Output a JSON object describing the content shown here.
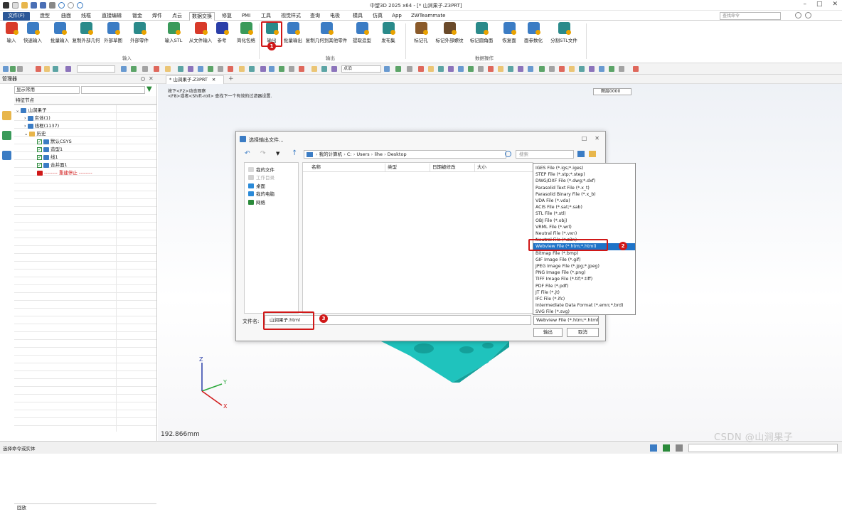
{
  "app_title": "中望3D 2025 x64 - [* 山涧果子.Z3PRT]",
  "search_cmd_placeholder": "查找命令",
  "menu": [
    "文件(F)",
    "造型",
    "曲面",
    "线框",
    "直接编辑",
    "钣金",
    "焊件",
    "点云",
    "数据交换",
    "修复",
    "PMI",
    "工具",
    "视觉样式",
    "查询",
    "电极",
    "模具",
    "仿真",
    "App",
    "ZWTeammate"
  ],
  "ribbon": {
    "buttons": [
      "输入",
      "快速输入",
      "批量输入",
      "复制外部几何",
      "外部草图",
      "外部零件",
      "输入STL",
      "从文件输入",
      "参考",
      "简化包络",
      "输出",
      "批量输出",
      "复制几何到其他零件",
      "提取造型",
      "发布集",
      "标记孔",
      "标记外部螺纹",
      "标记圆角面",
      "恢复面",
      "面参数化",
      "分割STL文件"
    ],
    "groups": [
      "输入",
      "输出",
      "数据操作"
    ]
  },
  "toolbar2": {
    "dropdown_value": "点沿"
  },
  "left_panel": {
    "title": "管理器",
    "filter_value": "显示常用",
    "column_header": "特征节点",
    "tree": [
      {
        "label": "山涧果子",
        "level": 0
      },
      {
        "label": "实体(1)",
        "level": 1
      },
      {
        "label": "线框(1137)",
        "level": 1
      },
      {
        "label": "历史",
        "level": 1
      },
      {
        "label": "默认CSYS",
        "level": 2
      },
      {
        "label": "造型1",
        "level": 2
      },
      {
        "label": "线1",
        "level": 2
      },
      {
        "label": "合并面1",
        "level": 2
      },
      {
        "label": "-------- 重建停止 --------",
        "level": 2
      }
    ],
    "bottom_label": "回放"
  },
  "doc_tab": "* 山涧果子.Z3PRT",
  "viewport": {
    "hint1": "按下<F2>动态观察",
    "hint2": "<F8>或者<Shift-roll> 查找下一个有效的过滤器设置.",
    "layer": "图层0000",
    "distance": "192.866mm",
    "axis_x": "X",
    "axis_y": "Y",
    "axis_z": "Z"
  },
  "dialog": {
    "title": "选择输出文件...",
    "address": [
      "我的计算机",
      "C:",
      "Users",
      "lihe",
      "Desktop"
    ],
    "search_placeholder": "搜索",
    "places": [
      "我的文件",
      "工作目录",
      "桌面",
      "我的电脑",
      "网络"
    ],
    "columns": [
      "名称",
      "类型",
      "日期被修改",
      "大小"
    ],
    "filename_label": "文件名:",
    "filename_value": "山涧果子.html",
    "filetype_value": "Webview File (*.htm;*.html)",
    "ok_label": "输出",
    "cancel_label": "取消"
  },
  "type_options": [
    "IGES File (*.igs;*.iges)",
    "STEP File (*.stp;*.step)",
    "DWG/DXF File (*.dwg;*.dxf)",
    "Parasolid Text File (*.x_t)",
    "Parasolid Binary File (*.x_b)",
    "VDA File (*.vda)",
    "ACIS File (*.sat;*.sab)",
    "STL File (*.stl)",
    "OBJ File (*.obj)",
    "VRML File (*.wrl)",
    "Neutral File (*.vxn)",
    "Neutral File (*.z3n)",
    "Webview File (*.htm;*.html)",
    "Bitmap File (*.bmp)",
    "GIF Image File (*.gif)",
    "JPEG Image File (*.jpg;*.jpeg)",
    "PNG Image File (*.png)",
    "TIFF Image File (*.tif;*.tiff)",
    "PDF File (*.pdf)",
    "JT File (*.jt)",
    "IFC File (*.ifc)",
    "Intermediate Data Format (*.emn;*.brd)",
    "SVG File (*.svg)"
  ],
  "badges": [
    "1",
    "2",
    "3"
  ],
  "status_text": "选择命令或实体",
  "watermark": "CSDN @山涧果子",
  "colors": {
    "accent": "#1e73c8",
    "highlight": "#d01818",
    "part": "#1fc3bd"
  }
}
